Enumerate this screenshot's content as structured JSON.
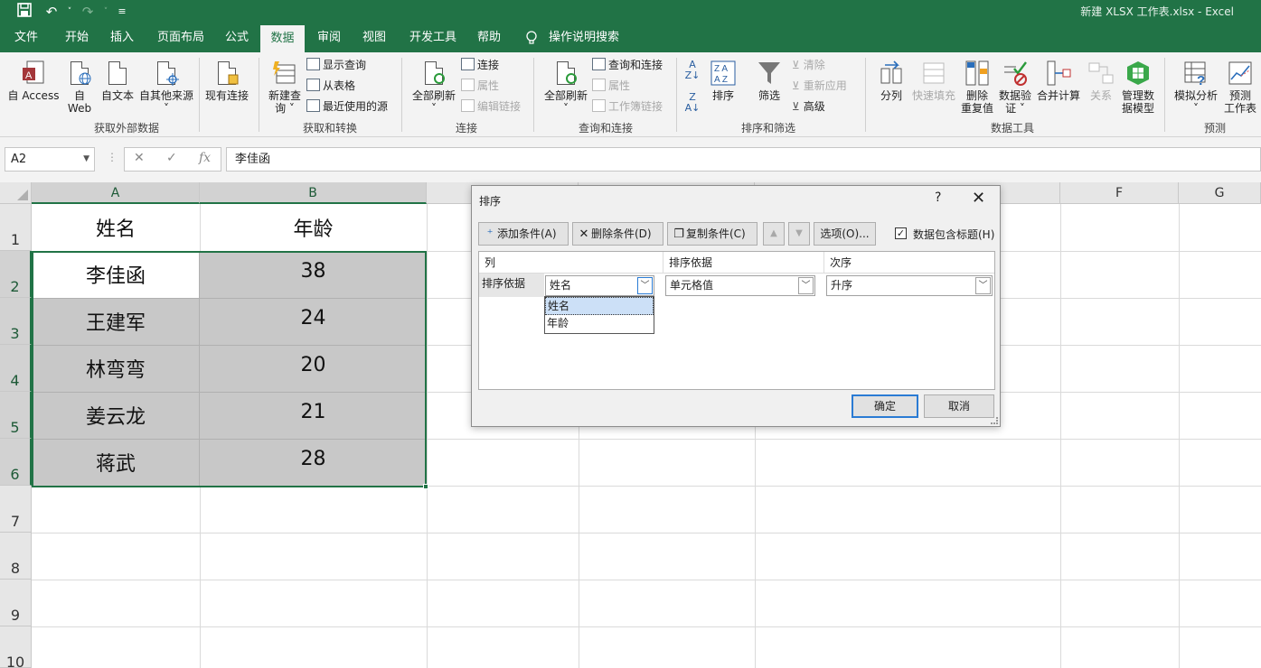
{
  "window": {
    "title": "新建 XLSX 工作表.xlsx  -  Excel"
  },
  "tabs": [
    "文件",
    "开始",
    "插入",
    "页面布局",
    "公式",
    "数据",
    "审阅",
    "视图",
    "开发工具",
    "帮助"
  ],
  "active_tab": "数据",
  "tell_me": "操作说明搜索",
  "ribbon": {
    "get_external": {
      "access": "自 Access",
      "web_1": "自",
      "web_2": "Web",
      "text": "自文本",
      "other": "自其他来源",
      "existing": "现有连接",
      "group": "获取外部数据"
    },
    "transform": {
      "new_query_1": "新建查",
      "new_query_2": "询 ˅",
      "show_query": "显示查询",
      "from_table": "从表格",
      "recent": "最近使用的源",
      "group": "获取和转换"
    },
    "connections": {
      "refresh_1": "全部刷新",
      "refresh_2": "˅",
      "connections": "连接",
      "properties": "属性",
      "edit_links": "编辑链接",
      "group": "连接"
    },
    "queries": {
      "refresh_1": "全部刷新",
      "refresh_2": "˅",
      "qc": "查询和连接",
      "properties": "属性",
      "wb_links": "工作簿链接",
      "group": "查询和连接"
    },
    "sort": {
      "sort": "排序",
      "filter": "筛选",
      "clear": "清除",
      "reapply": "重新应用",
      "advanced": "高级",
      "group": "排序和筛选"
    },
    "tools": {
      "split": "分列",
      "flash": "快速填充",
      "dedup_1": "删除",
      "dedup_2": "重复值",
      "valid_1": "数据验",
      "valid_2": "证 ˅",
      "consolidate": "合并计算",
      "relations": "关系",
      "model_1": "管理数",
      "model_2": "据模型",
      "group": "数据工具"
    },
    "forecast": {
      "whatif_1": "模拟分析",
      "whatif_2": "˅",
      "sheet_1": "预测",
      "sheet_2": "工作表",
      "group": "预测"
    }
  },
  "formula_bar": {
    "name_box": "A2",
    "cancel": "✕",
    "enter": "✓",
    "fx": "fx",
    "value": "李佳函"
  },
  "grid": {
    "columns": [
      "A",
      "B",
      "",
      "",
      "",
      "F",
      "G"
    ],
    "rows": [
      "1",
      "2",
      "3",
      "4",
      "5",
      "6",
      "7",
      "8",
      "9",
      "10"
    ],
    "cells": [
      [
        "姓名",
        "年龄"
      ],
      [
        "李佳函",
        "38"
      ],
      [
        "王建军",
        "24"
      ],
      [
        "林弯弯",
        "20"
      ],
      [
        "姜云龙",
        "21"
      ],
      [
        "蒋武",
        "28"
      ]
    ]
  },
  "dialog": {
    "title": "排序",
    "help": "?",
    "close": "✕",
    "add": "添加条件(A)",
    "delete": "删除条件(D)",
    "copy": "复制条件(C)",
    "up": "▲",
    "down": "▼",
    "options": "选项(O)...",
    "has_headers": "数据包含标题(H)",
    "headers": {
      "column": "列",
      "sort_on": "排序依据",
      "order": "次序"
    },
    "row_label": "排序依据",
    "column_value": "姓名",
    "sort_on_value": "单元格值",
    "order_value": "升序",
    "dropdown_options": [
      "姓名",
      "年龄"
    ],
    "ok": "确定",
    "cancel": "取消"
  },
  "colors": {
    "brand": "#217346",
    "selection": "#c8c8c8",
    "focus": "#2a7bd4"
  }
}
